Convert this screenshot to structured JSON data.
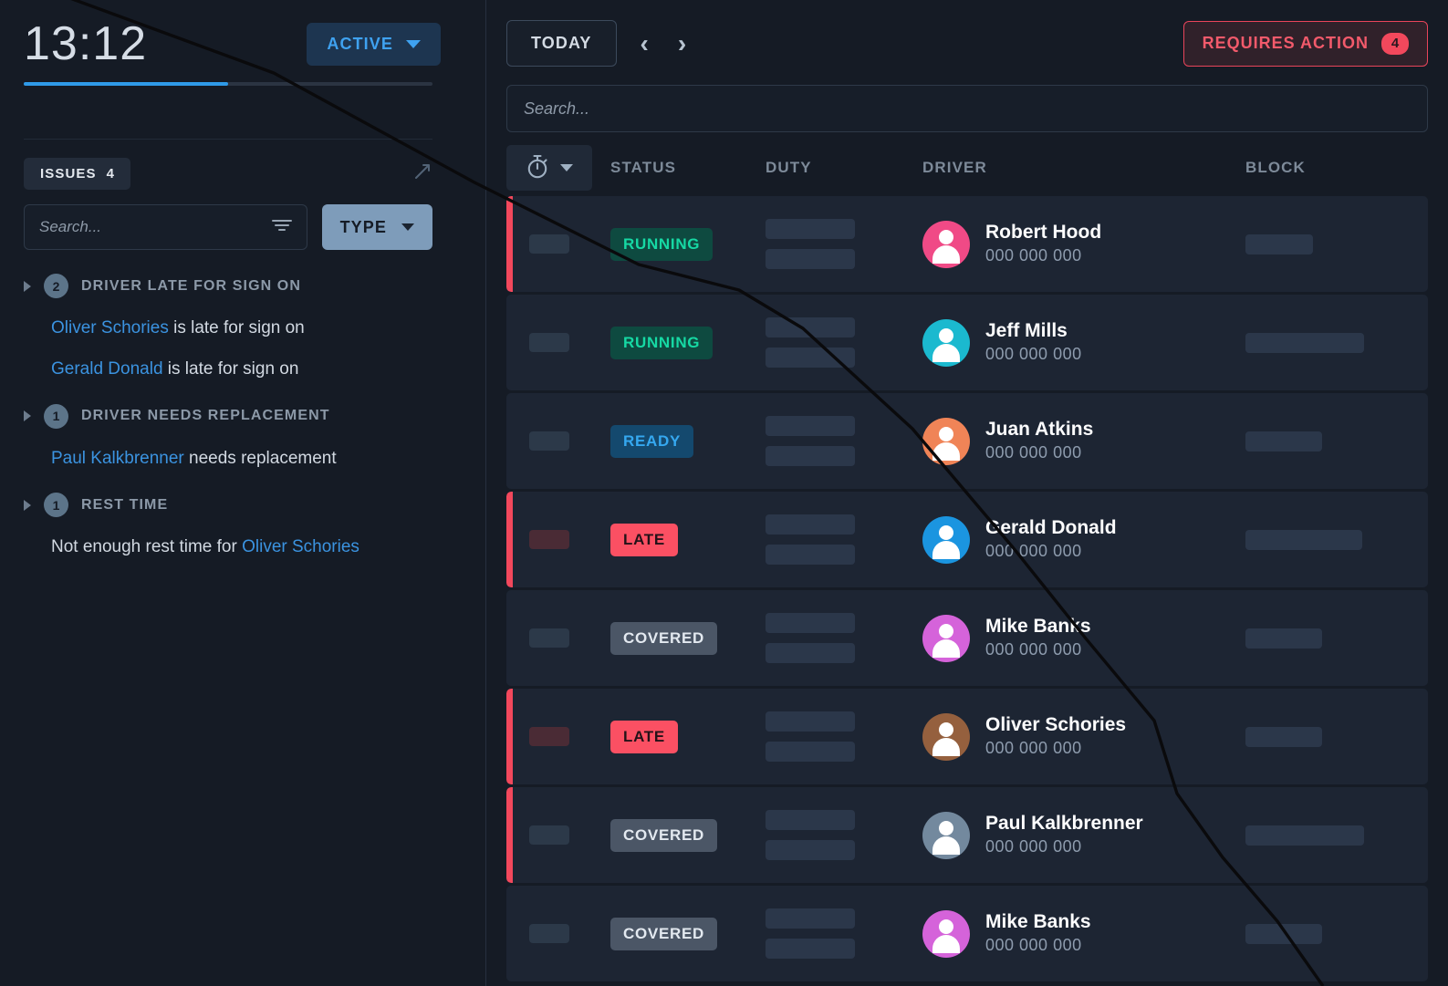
{
  "sidebar": {
    "clock": "13:12",
    "status_filter": {
      "label": "ACTIVE",
      "icon": "chevron-down-icon"
    },
    "progress_percent": 50,
    "issues_tab": {
      "label": "ISSUES",
      "count": "4"
    },
    "expand_icon": "expand-arrow-icon",
    "search": {
      "value": "",
      "placeholder": "Search...",
      "icon": "filter-icon"
    },
    "type_filter": {
      "label": "TYPE",
      "icon": "caret-down-icon"
    },
    "groups": [
      {
        "count": "2",
        "title": "DRIVER LATE FOR SIGN ON",
        "items": [
          {
            "link": "Oliver Schories",
            "text": " is late for sign on",
            "link_first": true
          },
          {
            "link": "Gerald Donald",
            "text": " is late for sign on",
            "link_first": true
          }
        ]
      },
      {
        "count": "1",
        "title": "DRIVER NEEDS REPLACEMENT",
        "items": [
          {
            "link": "Paul Kalkbrenner",
            "text": " needs replacement",
            "link_first": true
          }
        ]
      },
      {
        "count": "1",
        "title": "REST TIME",
        "items": [
          {
            "link": "Oliver Schories",
            "text": "Not enough rest time for ",
            "link_first": false
          }
        ]
      }
    ]
  },
  "main": {
    "today_button": "TODAY",
    "prev_icon": "chevron-left-icon",
    "next_icon": "chevron-right-icon",
    "requires_action": {
      "label": "REQUIRES ACTION",
      "count": "4"
    },
    "search": {
      "value": "",
      "placeholder": "Search..."
    },
    "columns": {
      "timer_icon": "stopwatch-icon",
      "timer_caret": "caret-down-icon",
      "status": "STATUS",
      "duty": "DUTY",
      "driver": "DRIVER",
      "block": "BLOCK"
    },
    "rows": [
      {
        "alert": true,
        "status": "RUNNING",
        "status_kind": "running",
        "chip_kind": "normal",
        "name": "Robert Hood",
        "phone": "000 000 000",
        "avatar_color": "#f04a86",
        "block_width": 74
      },
      {
        "alert": false,
        "status": "RUNNING",
        "status_kind": "running",
        "chip_kind": "normal",
        "name": "Jeff Mills",
        "phone": "000 000 000",
        "avatar_color": "#1bb9cf",
        "block_width": 130
      },
      {
        "alert": false,
        "status": "READY",
        "status_kind": "ready",
        "chip_kind": "normal",
        "name": "Juan Atkins",
        "phone": "000 000 000",
        "avatar_color": "#f08457",
        "block_width": 84
      },
      {
        "alert": true,
        "status": "LATE",
        "status_kind": "late",
        "chip_kind": "red",
        "name": "Gerald Donald",
        "phone": "000 000 000",
        "avatar_color": "#1b95e0",
        "block_width": 128
      },
      {
        "alert": false,
        "status": "COVERED",
        "status_kind": "covered",
        "chip_kind": "normal",
        "name": "Mike Banks",
        "phone": "000 000 000",
        "avatar_color": "#d563da",
        "block_width": 84
      },
      {
        "alert": true,
        "status": "LATE",
        "status_kind": "late",
        "chip_kind": "red",
        "name": "Oliver Schories",
        "phone": "000 000 000",
        "avatar_color": "#95603e",
        "block_width": 84
      },
      {
        "alert": true,
        "status": "COVERED",
        "status_kind": "covered",
        "chip_kind": "normal",
        "name": "Paul Kalkbrenner",
        "phone": "000 000 000",
        "avatar_color": "#73899e",
        "block_width": 130
      },
      {
        "alert": false,
        "status": "COVERED",
        "status_kind": "covered",
        "chip_kind": "normal",
        "name": "Mike Banks",
        "phone": "000 000 000",
        "avatar_color": "#d563da",
        "block_width": 84
      }
    ]
  },
  "colors": {
    "accent_blue": "#3fa2f0",
    "alert_red": "#f2485c",
    "running_green": "#16d9a4",
    "ready_blue": "#35a8f0",
    "covered_grey": "#4b5666",
    "background": "#151b25",
    "row_background": "#1d2533"
  }
}
